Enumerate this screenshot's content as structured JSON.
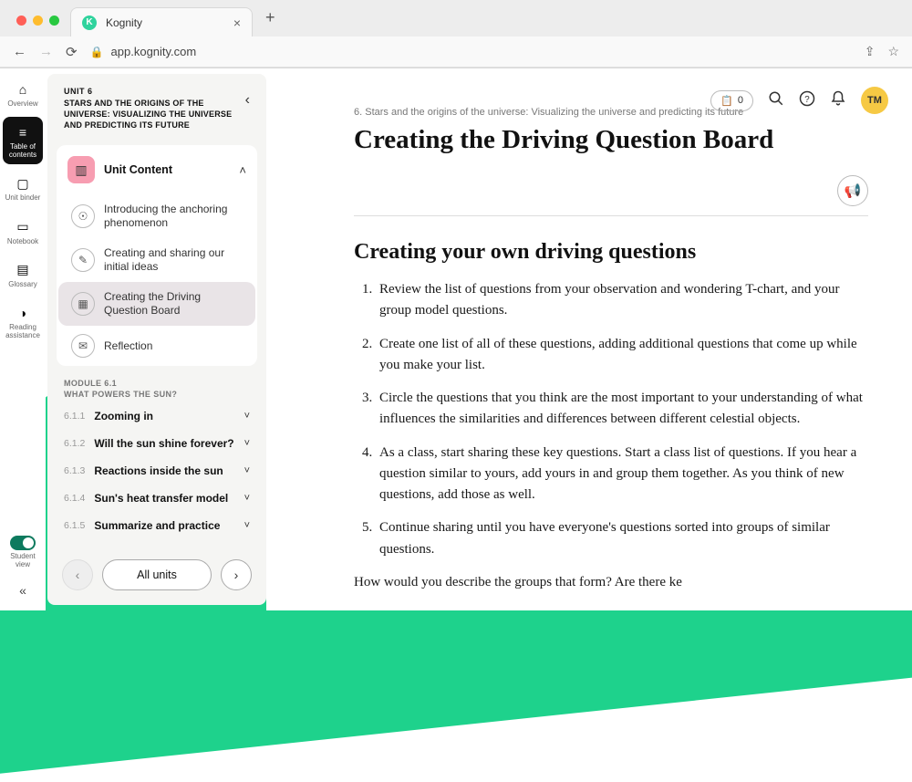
{
  "browser": {
    "tab_title": "Kognity",
    "url": "app.kognity.com"
  },
  "rail": {
    "items": [
      {
        "label": "Overview"
      },
      {
        "label": "Table of contents"
      },
      {
        "label": "Unit binder"
      },
      {
        "label": "Notebook"
      },
      {
        "label": "Glossary"
      },
      {
        "label": "Reading assistance"
      }
    ],
    "student_view_label": "Student view"
  },
  "toc": {
    "unit_num": "UNIT 6",
    "unit_title": "STARS AND THE ORIGINS OF THE UNIVERSE: VISUALIZING THE UNIVERSE AND PREDICTING ITS FUTURE",
    "section_title": "Unit Content",
    "items": [
      {
        "label": "Introducing the anchoring phenomenon"
      },
      {
        "label": "Creating and sharing our initial ideas"
      },
      {
        "label": "Creating the Driving Question Board"
      },
      {
        "label": "Reflection"
      }
    ],
    "module_num": "MODULE 6.1",
    "module_title": "WHAT POWERS THE SUN?",
    "module_rows": [
      {
        "idx": "6.1.1",
        "title": "Zooming in"
      },
      {
        "idx": "6.1.2",
        "title": "Will the sun shine forever?"
      },
      {
        "idx": "6.1.3",
        "title": "Reactions inside the sun"
      },
      {
        "idx": "6.1.4",
        "title": "Sun's heat transfer model"
      },
      {
        "idx": "6.1.5",
        "title": "Summarize and practice"
      }
    ],
    "all_units_label": "All units"
  },
  "topbar": {
    "assign_count": "0",
    "avatar": "TM"
  },
  "content": {
    "breadcrumb": "6. Stars and the origins of the universe: Visualizing the universe and predicting its future",
    "title": "Creating the Driving Question Board",
    "section_heading": "Creating your own driving questions",
    "steps": [
      "Review the list of questions from your observation and wondering T-chart, and your group model questions.",
      "Create one list of all of these questions, adding additional questions that come up while you make your list.",
      "Circle the questions that you think are the most important to your understanding of what influences the similarities and differences between different celestial objects.",
      "As a class, start sharing these key questions. Start a class list of questions. If you hear a question similar to yours, add yours in and group them together.  As you think of new questions, add those as well.",
      "Continue sharing until you have everyone's questions sorted into groups of similar questions."
    ],
    "para": "How would you describe the groups that form? Are there ke"
  }
}
